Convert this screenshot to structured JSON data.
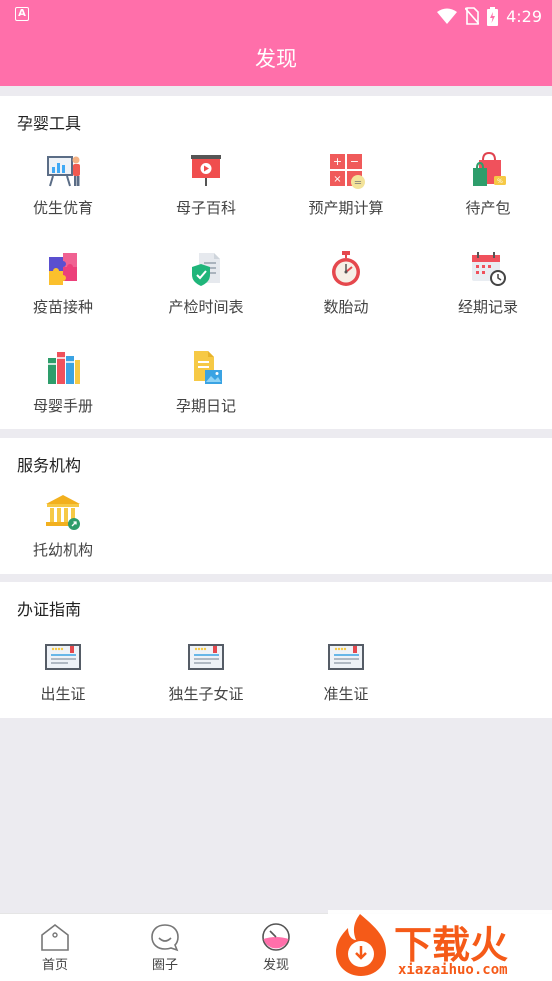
{
  "status_bar": {
    "time": "4:29",
    "left_icon": "A"
  },
  "header": {
    "title": "发现"
  },
  "sections": [
    {
      "title": "孕婴工具",
      "items": [
        {
          "label": "优生优育",
          "icon": "presentation-icon"
        },
        {
          "label": "母子百科",
          "icon": "video-board-icon"
        },
        {
          "label": "预产期计算",
          "icon": "calculator-icon"
        },
        {
          "label": "待产包",
          "icon": "shopping-bags-icon"
        },
        {
          "label": "疫苗接种",
          "icon": "puzzle-icon"
        },
        {
          "label": "产检时间表",
          "icon": "shield-document-icon"
        },
        {
          "label": "数胎动",
          "icon": "stopwatch-icon"
        },
        {
          "label": "经期记录",
          "icon": "calendar-clock-icon"
        },
        {
          "label": "母婴手册",
          "icon": "books-icon"
        },
        {
          "label": "孕期日记",
          "icon": "diary-icon"
        }
      ]
    },
    {
      "title": "服务机构",
      "items": [
        {
          "label": "托幼机构",
          "icon": "institution-icon"
        }
      ]
    },
    {
      "title": "办证指南",
      "items": [
        {
          "label": "出生证",
          "icon": "certificate-icon"
        },
        {
          "label": "独生子女证",
          "icon": "certificate-icon"
        },
        {
          "label": "准生证",
          "icon": "certificate-icon"
        }
      ]
    }
  ],
  "tabbar": [
    {
      "label": "首页",
      "icon": "home-icon"
    },
    {
      "label": "圈子",
      "icon": "chat-bubble-icon"
    },
    {
      "label": "发现",
      "icon": "discover-icon",
      "active": true
    }
  ],
  "watermark": {
    "cn": "下载火",
    "en": "xiazaihuo.com"
  },
  "colors": {
    "brand": "#ff6faa",
    "background": "#ecebf0",
    "watermark": "#f55a18"
  }
}
